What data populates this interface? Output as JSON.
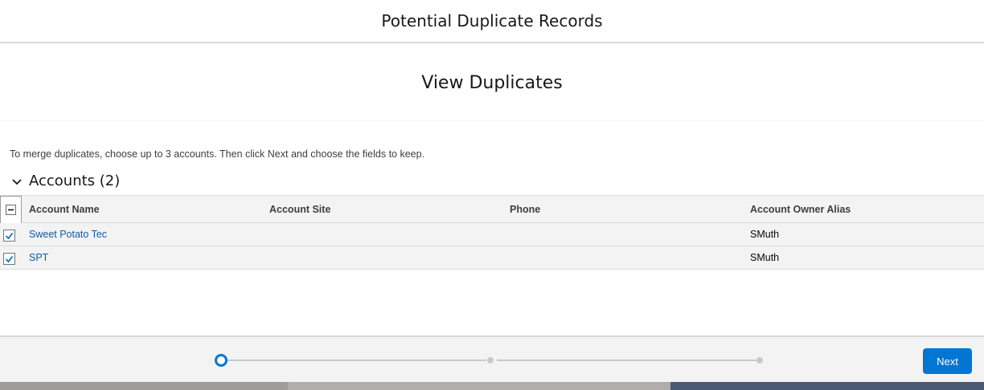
{
  "header": {
    "title": "Potential Duplicate Records"
  },
  "subheader": {
    "title": "View Duplicates"
  },
  "instructions": "To merge duplicates, choose up to 3 accounts. Then click Next and choose the fields to keep.",
  "section": {
    "title": "Accounts (2)"
  },
  "table": {
    "columns": [
      "Account Name",
      "Account Site",
      "Phone",
      "Account Owner Alias"
    ],
    "rows": [
      {
        "name": "Sweet Potato Tec",
        "site": "",
        "phone": "",
        "owner": "SMuth",
        "checked": true
      },
      {
        "name": "SPT",
        "site": "",
        "phone": "",
        "owner": "SMuth",
        "checked": true
      }
    ]
  },
  "footer": {
    "next_label": "Next",
    "steps_total": 3,
    "current_step": 1
  },
  "colors": {
    "brand": "#0176d3",
    "link": "#0b5cab"
  }
}
